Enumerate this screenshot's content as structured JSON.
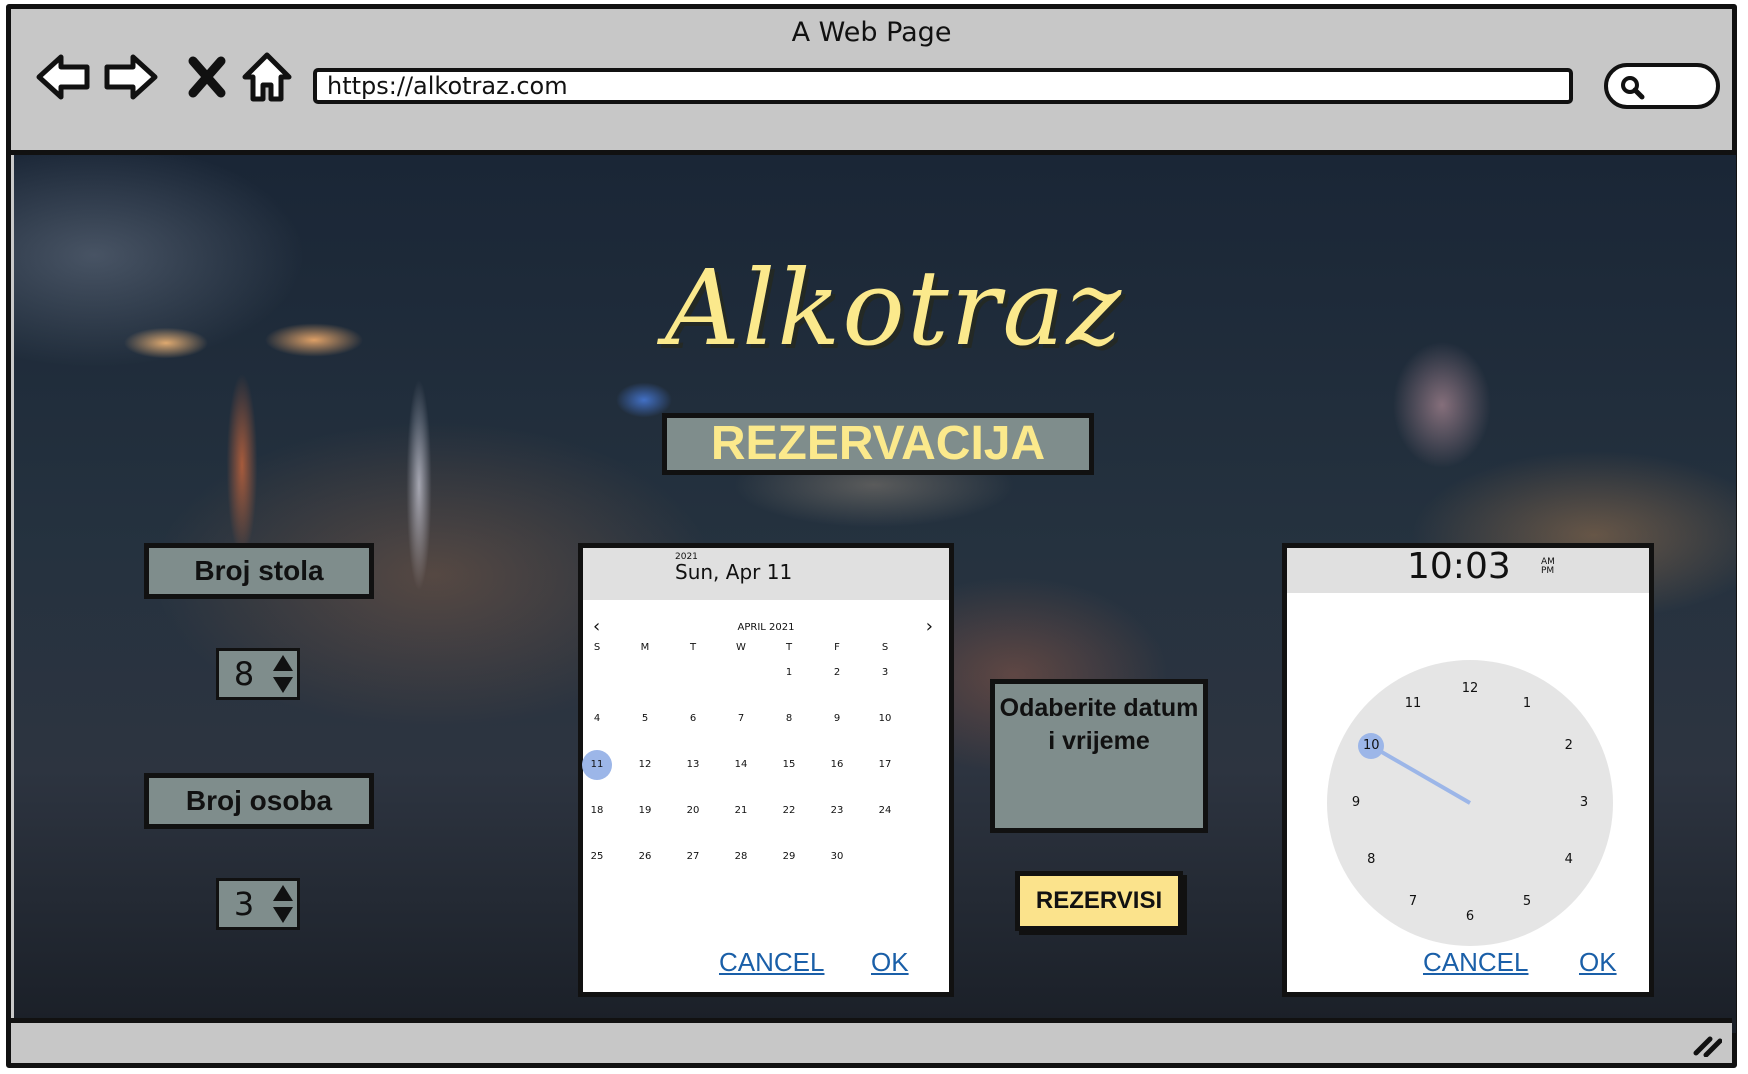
{
  "browser": {
    "window_title": "A Web Page",
    "url": "https://alkotraz.com"
  },
  "page": {
    "logo": "Alkotraz",
    "heading": "REZERVACIJA",
    "table_label": "Broj stola",
    "table_value": "8",
    "persons_label": "Broj osoba",
    "persons_value": "3",
    "instruction": "Odaberite datum i vrijeme",
    "reserve_button": "REZERVISI"
  },
  "date_picker": {
    "year": "2021",
    "selected_date": "Sun, Apr 11",
    "month_label": "APRIL 2021",
    "weekdays": [
      "S",
      "M",
      "T",
      "W",
      "T",
      "F",
      "S"
    ],
    "weeks": [
      [
        "",
        "",
        "",
        "",
        "1",
        "2",
        "3"
      ],
      [
        "4",
        "5",
        "6",
        "7",
        "8",
        "9",
        "10"
      ],
      [
        "11",
        "12",
        "13",
        "14",
        "15",
        "16",
        "17"
      ],
      [
        "18",
        "19",
        "20",
        "21",
        "22",
        "23",
        "24"
      ],
      [
        "25",
        "26",
        "27",
        "28",
        "29",
        "30",
        ""
      ]
    ],
    "selected_day": "11",
    "cancel": "CANCEL",
    "ok": "OK"
  },
  "time_picker": {
    "time": "10:03",
    "am": "AM",
    "pm": "PM",
    "hours": [
      "12",
      "1",
      "2",
      "3",
      "4",
      "5",
      "6",
      "7",
      "8",
      "9",
      "10",
      "11"
    ],
    "selected_hour": "10",
    "cancel": "CANCEL",
    "ok": "OK"
  },
  "colors": {
    "accent_yellow": "#fbe98c",
    "panel_gray": "#7f8d8c",
    "selection_blue": "#9cb6e8",
    "link_blue": "#1a5fa8"
  }
}
